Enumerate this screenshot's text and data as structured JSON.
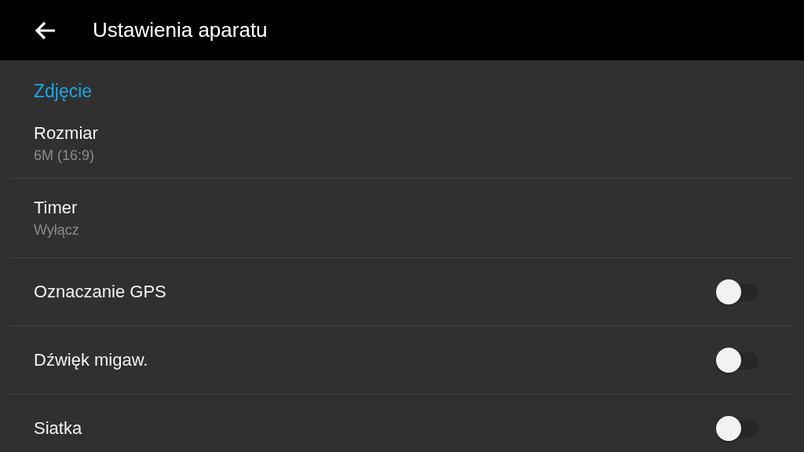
{
  "header": {
    "title": "Ustawienia aparatu"
  },
  "section": {
    "title": "Zdjęcie"
  },
  "settings": [
    {
      "kind": "value",
      "title": "Rozmiar",
      "summary": "6M (16:9)"
    },
    {
      "kind": "value",
      "title": "Timer",
      "summary": "Wyłącz"
    },
    {
      "kind": "switch",
      "title": "Oznaczanie GPS",
      "on": false
    },
    {
      "kind": "switch",
      "title": "Dźwięk migaw.",
      "on": false
    },
    {
      "kind": "switch",
      "title": "Siatka",
      "on": false
    }
  ]
}
